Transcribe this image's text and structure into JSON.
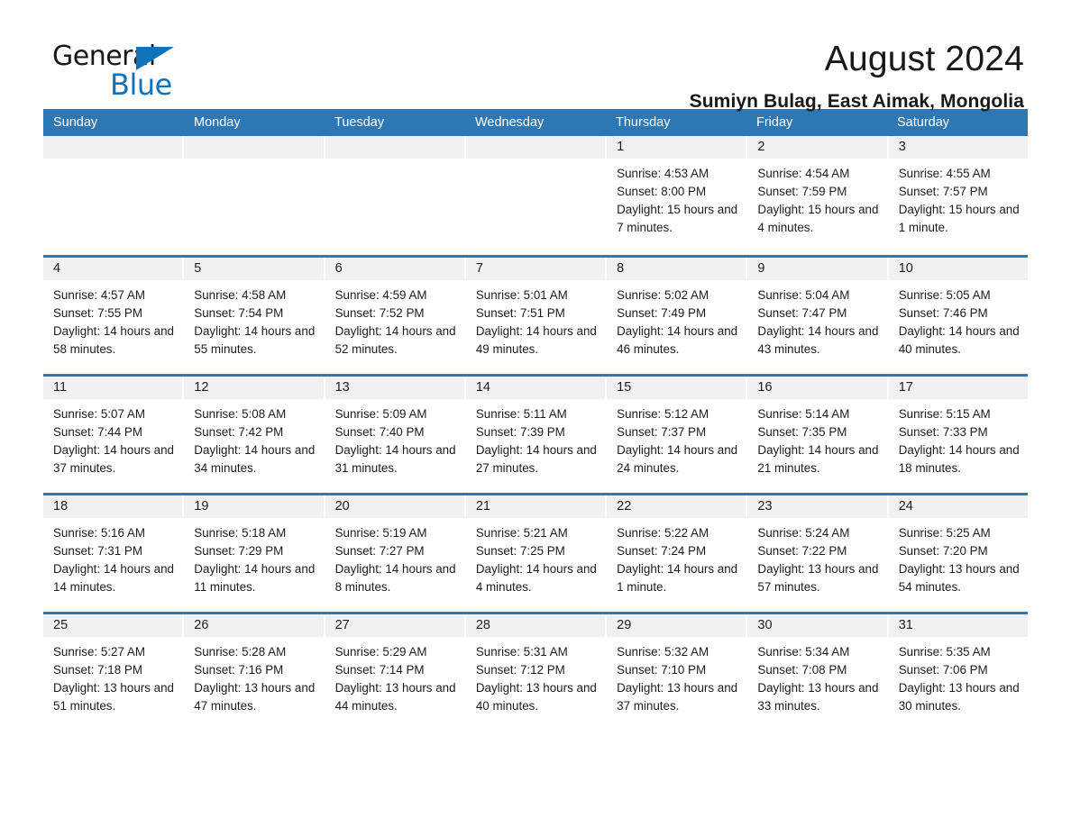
{
  "brand": {
    "name_part1": "General",
    "name_part2": "Blue"
  },
  "header": {
    "title": "August 2024",
    "subtitle": "Sumiyn Bulag, East Aimak, Mongolia"
  },
  "colors": {
    "header_blue": "#2e77b5",
    "daynum_gray": "#f1f1f1",
    "logo_blue": "#1272b8"
  },
  "weekdays": [
    "Sunday",
    "Monday",
    "Tuesday",
    "Wednesday",
    "Thursday",
    "Friday",
    "Saturday"
  ],
  "labels": {
    "sunrise_prefix": "Sunrise:",
    "sunset_prefix": "Sunset:",
    "daylight_prefix": "Daylight:"
  },
  "weeks": [
    [
      {
        "day": "",
        "empty": true
      },
      {
        "day": "",
        "empty": true
      },
      {
        "day": "",
        "empty": true
      },
      {
        "day": "",
        "empty": true
      },
      {
        "day": "1",
        "sunrise": "Sunrise: 4:53 AM",
        "sunset": "Sunset: 8:00 PM",
        "daylight": "Daylight: 15 hours and 7 minutes."
      },
      {
        "day": "2",
        "sunrise": "Sunrise: 4:54 AM",
        "sunset": "Sunset: 7:59 PM",
        "daylight": "Daylight: 15 hours and 4 minutes."
      },
      {
        "day": "3",
        "sunrise": "Sunrise: 4:55 AM",
        "sunset": "Sunset: 7:57 PM",
        "daylight": "Daylight: 15 hours and 1 minute."
      }
    ],
    [
      {
        "day": "4",
        "sunrise": "Sunrise: 4:57 AM",
        "sunset": "Sunset: 7:55 PM",
        "daylight": "Daylight: 14 hours and 58 minutes."
      },
      {
        "day": "5",
        "sunrise": "Sunrise: 4:58 AM",
        "sunset": "Sunset: 7:54 PM",
        "daylight": "Daylight: 14 hours and 55 minutes."
      },
      {
        "day": "6",
        "sunrise": "Sunrise: 4:59 AM",
        "sunset": "Sunset: 7:52 PM",
        "daylight": "Daylight: 14 hours and 52 minutes."
      },
      {
        "day": "7",
        "sunrise": "Sunrise: 5:01 AM",
        "sunset": "Sunset: 7:51 PM",
        "daylight": "Daylight: 14 hours and 49 minutes."
      },
      {
        "day": "8",
        "sunrise": "Sunrise: 5:02 AM",
        "sunset": "Sunset: 7:49 PM",
        "daylight": "Daylight: 14 hours and 46 minutes."
      },
      {
        "day": "9",
        "sunrise": "Sunrise: 5:04 AM",
        "sunset": "Sunset: 7:47 PM",
        "daylight": "Daylight: 14 hours and 43 minutes."
      },
      {
        "day": "10",
        "sunrise": "Sunrise: 5:05 AM",
        "sunset": "Sunset: 7:46 PM",
        "daylight": "Daylight: 14 hours and 40 minutes."
      }
    ],
    [
      {
        "day": "11",
        "sunrise": "Sunrise: 5:07 AM",
        "sunset": "Sunset: 7:44 PM",
        "daylight": "Daylight: 14 hours and 37 minutes."
      },
      {
        "day": "12",
        "sunrise": "Sunrise: 5:08 AM",
        "sunset": "Sunset: 7:42 PM",
        "daylight": "Daylight: 14 hours and 34 minutes."
      },
      {
        "day": "13",
        "sunrise": "Sunrise: 5:09 AM",
        "sunset": "Sunset: 7:40 PM",
        "daylight": "Daylight: 14 hours and 31 minutes."
      },
      {
        "day": "14",
        "sunrise": "Sunrise: 5:11 AM",
        "sunset": "Sunset: 7:39 PM",
        "daylight": "Daylight: 14 hours and 27 minutes."
      },
      {
        "day": "15",
        "sunrise": "Sunrise: 5:12 AM",
        "sunset": "Sunset: 7:37 PM",
        "daylight": "Daylight: 14 hours and 24 minutes."
      },
      {
        "day": "16",
        "sunrise": "Sunrise: 5:14 AM",
        "sunset": "Sunset: 7:35 PM",
        "daylight": "Daylight: 14 hours and 21 minutes."
      },
      {
        "day": "17",
        "sunrise": "Sunrise: 5:15 AM",
        "sunset": "Sunset: 7:33 PM",
        "daylight": "Daylight: 14 hours and 18 minutes."
      }
    ],
    [
      {
        "day": "18",
        "sunrise": "Sunrise: 5:16 AM",
        "sunset": "Sunset: 7:31 PM",
        "daylight": "Daylight: 14 hours and 14 minutes."
      },
      {
        "day": "19",
        "sunrise": "Sunrise: 5:18 AM",
        "sunset": "Sunset: 7:29 PM",
        "daylight": "Daylight: 14 hours and 11 minutes."
      },
      {
        "day": "20",
        "sunrise": "Sunrise: 5:19 AM",
        "sunset": "Sunset: 7:27 PM",
        "daylight": "Daylight: 14 hours and 8 minutes."
      },
      {
        "day": "21",
        "sunrise": "Sunrise: 5:21 AM",
        "sunset": "Sunset: 7:25 PM",
        "daylight": "Daylight: 14 hours and 4 minutes."
      },
      {
        "day": "22",
        "sunrise": "Sunrise: 5:22 AM",
        "sunset": "Sunset: 7:24 PM",
        "daylight": "Daylight: 14 hours and 1 minute."
      },
      {
        "day": "23",
        "sunrise": "Sunrise: 5:24 AM",
        "sunset": "Sunset: 7:22 PM",
        "daylight": "Daylight: 13 hours and 57 minutes."
      },
      {
        "day": "24",
        "sunrise": "Sunrise: 5:25 AM",
        "sunset": "Sunset: 7:20 PM",
        "daylight": "Daylight: 13 hours and 54 minutes."
      }
    ],
    [
      {
        "day": "25",
        "sunrise": "Sunrise: 5:27 AM",
        "sunset": "Sunset: 7:18 PM",
        "daylight": "Daylight: 13 hours and 51 minutes."
      },
      {
        "day": "26",
        "sunrise": "Sunrise: 5:28 AM",
        "sunset": "Sunset: 7:16 PM",
        "daylight": "Daylight: 13 hours and 47 minutes."
      },
      {
        "day": "27",
        "sunrise": "Sunrise: 5:29 AM",
        "sunset": "Sunset: 7:14 PM",
        "daylight": "Daylight: 13 hours and 44 minutes."
      },
      {
        "day": "28",
        "sunrise": "Sunrise: 5:31 AM",
        "sunset": "Sunset: 7:12 PM",
        "daylight": "Daylight: 13 hours and 40 minutes."
      },
      {
        "day": "29",
        "sunrise": "Sunrise: 5:32 AM",
        "sunset": "Sunset: 7:10 PM",
        "daylight": "Daylight: 13 hours and 37 minutes."
      },
      {
        "day": "30",
        "sunrise": "Sunrise: 5:34 AM",
        "sunset": "Sunset: 7:08 PM",
        "daylight": "Daylight: 13 hours and 33 minutes."
      },
      {
        "day": "31",
        "sunrise": "Sunrise: 5:35 AM",
        "sunset": "Sunset: 7:06 PM",
        "daylight": "Daylight: 13 hours and 30 minutes."
      }
    ]
  ]
}
